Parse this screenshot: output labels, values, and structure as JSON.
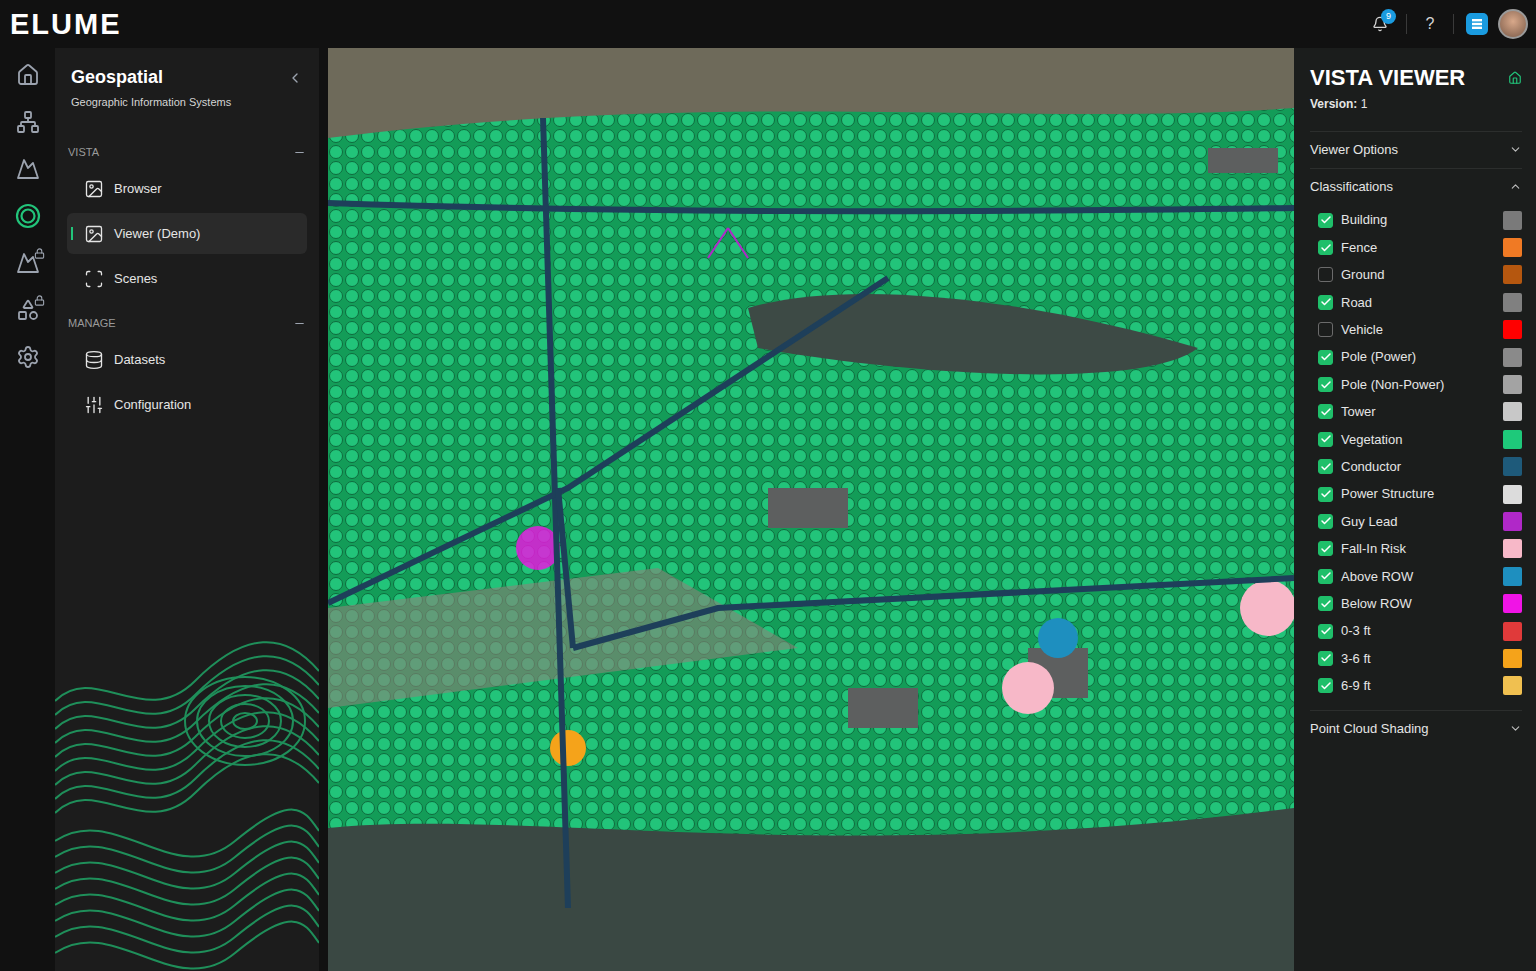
{
  "app": {
    "logo": "ELUME",
    "notifications": "9",
    "help": "?"
  },
  "rail": [
    {
      "kind": "home",
      "selected": false
    },
    {
      "kind": "network",
      "selected": false
    },
    {
      "kind": "terrain",
      "selected": false
    },
    {
      "kind": "vista",
      "selected": true
    },
    {
      "kind": "terrain-locked",
      "selected": false
    },
    {
      "kind": "shapes-locked",
      "selected": false
    },
    {
      "kind": "settings",
      "selected": false
    }
  ],
  "sidebar": {
    "title": "Geospatial",
    "subtitle": "Geographic Information Systems",
    "sections": [
      {
        "label": "VISTA",
        "expanded": true,
        "items": [
          {
            "label": "Browser",
            "kind": "image",
            "selected": false
          },
          {
            "label": "Viewer (Demo)",
            "kind": "image",
            "selected": true
          },
          {
            "label": "Scenes",
            "kind": "scan",
            "selected": false
          }
        ]
      },
      {
        "label": "MANAGE",
        "expanded": true,
        "items": [
          {
            "label": "Datasets",
            "kind": "database",
            "selected": false
          },
          {
            "label": "Configuration",
            "kind": "sliders",
            "selected": false
          }
        ]
      }
    ]
  },
  "viewer": {
    "title": "VISTA VIEWER",
    "version_label": "Version:",
    "version": "1",
    "panels": [
      {
        "label": "Viewer Options",
        "expanded": false
      },
      {
        "label": "Classifications",
        "expanded": true,
        "items": [
          {
            "label": "Building",
            "checked": true,
            "color": "#7a7a7a"
          },
          {
            "label": "Fence",
            "checked": true,
            "color": "#f07a24"
          },
          {
            "label": "Ground",
            "checked": false,
            "color": "#b5570f"
          },
          {
            "label": "Road",
            "checked": true,
            "color": "#808080"
          },
          {
            "label": "Vehicle",
            "checked": false,
            "color": "#ff0000"
          },
          {
            "label": "Pole (Power)",
            "checked": true,
            "color": "#8a8a8a"
          },
          {
            "label": "Pole (Non-Power)",
            "checked": true,
            "color": "#a3a3a3"
          },
          {
            "label": "Tower",
            "checked": true,
            "color": "#c8c8c8"
          },
          {
            "label": "Vegetation",
            "checked": true,
            "color": "#1ec97a"
          },
          {
            "label": "Conductor",
            "checked": true,
            "color": "#1e5a7a"
          },
          {
            "label": "Power Structure",
            "checked": true,
            "color": "#dcdcdc"
          },
          {
            "label": "Guy Lead",
            "checked": true,
            "color": "#b028c8"
          },
          {
            "label": "Fall-In Risk",
            "checked": true,
            "color": "#f7b8c8"
          },
          {
            "label": "Above ROW",
            "checked": true,
            "color": "#1e8fbf"
          },
          {
            "label": "Below ROW",
            "checked": true,
            "color": "#f014e6"
          },
          {
            "label": "0-3 ft",
            "checked": true,
            "color": "#e03a3a"
          },
          {
            "label": "3-6 ft",
            "checked": true,
            "color": "#f5a31a"
          },
          {
            "label": "6-9 ft",
            "checked": true,
            "color": "#f0c050"
          }
        ]
      },
      {
        "label": "Point Cloud Shading",
        "expanded": false
      }
    ]
  }
}
